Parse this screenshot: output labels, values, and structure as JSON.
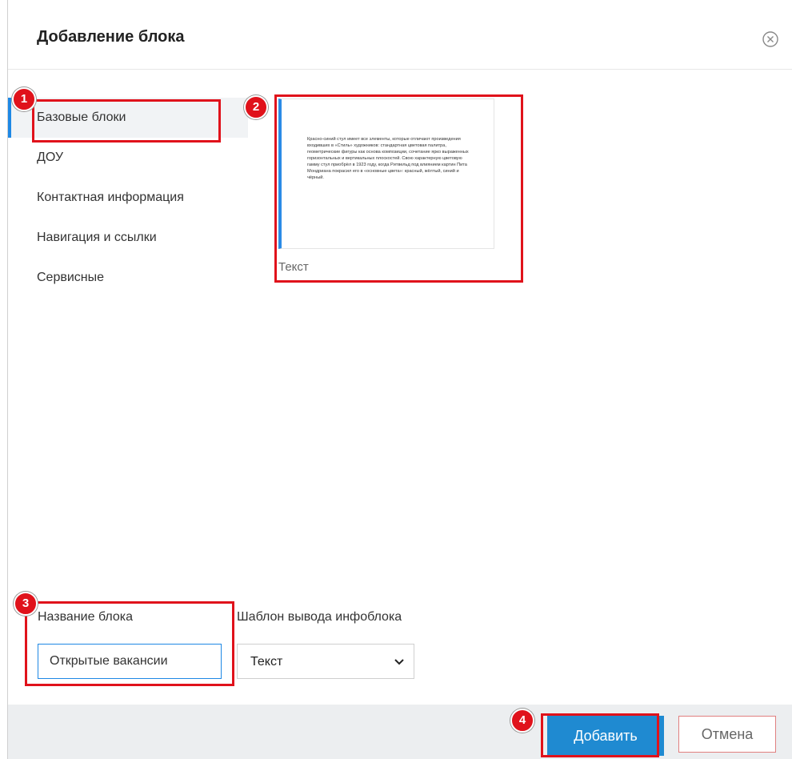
{
  "dialog": {
    "title": "Добавление блока",
    "close_icon": "close-circle-icon"
  },
  "sidebar": {
    "items": [
      {
        "label": "Базовые блоки"
      },
      {
        "label": "ДОУ"
      },
      {
        "label": "Контактная информация"
      },
      {
        "label": "Навигация и ссылки"
      },
      {
        "label": "Сервисные"
      }
    ]
  },
  "block_card": {
    "preview_text": "Красно-синий стул имеет все элементы, которые отличают произведения входивших в «Стиль» художников: стандартная цветовая палитра, геометрические фигуры как основа композиции, сочетание ярко выраженных горизонтальных и вертикальных плоскостей. Свою характерную цветовую гамму стул приобрёл в 1923 году, когда Ритвельд под влиянием картин Пита Мондриана покрасил его в «основные цвета»: красный, жёлтый, синий и чёрный.",
    "label": "Текст"
  },
  "form": {
    "name_label": "Название блока",
    "name_value": "Открытые вакансии",
    "template_label": "Шаблон вывода инфоблока",
    "template_value": "Текст"
  },
  "footer": {
    "add_label": "Добавить",
    "cancel_label": "Отмена"
  },
  "annotations": [
    "1",
    "2",
    "3",
    "4"
  ],
  "colors": {
    "accent": "#1e88e5",
    "button_primary": "#1f8ad1",
    "highlight": "#e0121b"
  }
}
